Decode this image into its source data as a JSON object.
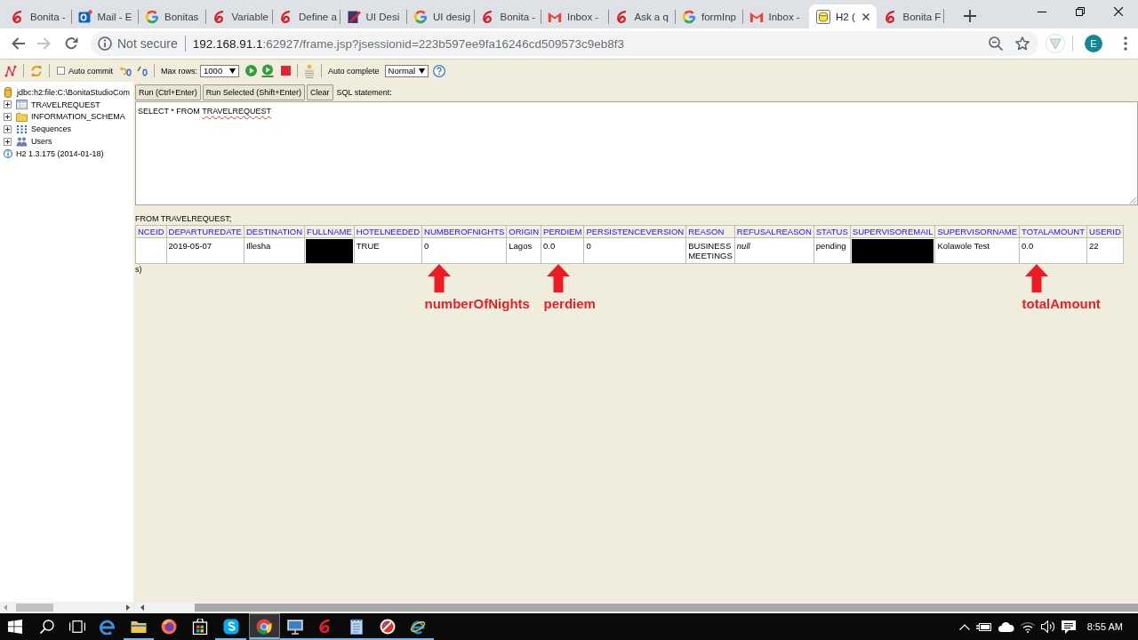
{
  "browser": {
    "tabs": [
      {
        "label": "Bonita -",
        "kind": "bonita",
        "selected": false
      },
      {
        "label": "Mail - E",
        "kind": "outlook",
        "selected": false
      },
      {
        "label": "Bonitas",
        "kind": "google",
        "selected": false
      },
      {
        "label": "Variable",
        "kind": "bonita",
        "selected": false
      },
      {
        "label": "Define a",
        "kind": "bonita",
        "selected": false
      },
      {
        "label": "UI Desi",
        "kind": "book",
        "selected": false
      },
      {
        "label": "UI desig",
        "kind": "google",
        "selected": false
      },
      {
        "label": "Bonita -",
        "kind": "bonita",
        "selected": false
      },
      {
        "label": "Inbox -",
        "kind": "gmail",
        "selected": false
      },
      {
        "label": "Ask a q",
        "kind": "bonita",
        "selected": false
      },
      {
        "label": "formInp",
        "kind": "google",
        "selected": false
      },
      {
        "label": "Inbox -",
        "kind": "gmail",
        "selected": false
      },
      {
        "label": "H2 (",
        "kind": "h2",
        "selected": true
      },
      {
        "label": "Bonita F",
        "kind": "bonita",
        "selected": false
      }
    ],
    "address": {
      "security": "Not secure",
      "host": "192.168.91.1",
      "path": ":62927/frame.jsp?jsessionid=223b597ee9fa16246cd509573c9eb8f3"
    },
    "profile": "E"
  },
  "toolbar": {
    "auto_commit": {
      "label": "Auto commit",
      "checked": false
    },
    "max_rows": {
      "label": "Max rows:",
      "value": "1000"
    },
    "auto_complete": {
      "label": "Auto complete",
      "value": "Normal"
    }
  },
  "sidebar": {
    "connection": "jdbc:h2:file:C:\\BonitaStudioCom",
    "items": [
      {
        "label": "TRAVELREQUEST",
        "kind": "table",
        "expanded": false
      },
      {
        "label": "INFORMATION_SCHEMA",
        "kind": "folder",
        "expanded": false
      },
      {
        "label": "Sequences",
        "kind": "sequences",
        "expanded": false
      },
      {
        "label": "Users",
        "kind": "users",
        "expanded": false
      }
    ],
    "version": "H2 1.3.175 (2014-01-18)"
  },
  "editor": {
    "buttons": [
      "Run (Ctrl+Enter)",
      "Run Selected (Shift+Enter)",
      "Clear"
    ],
    "label": "SQL statement:",
    "query": [
      {
        "text": "SELECT * FROM ",
        "misspelled": false
      },
      {
        "text": "TRAVELREQUEST",
        "misspelled": true
      }
    ]
  },
  "results": {
    "statement": "FROM TRAVELREQUEST;",
    "columns": [
      {
        "label": "NCEID"
      },
      {
        "label": "DEPARTUREDATE"
      },
      {
        "label": "DESTINATION"
      },
      {
        "label": "FULLNAME"
      },
      {
        "label": "HOTELNEEDED"
      },
      {
        "label": "NUMBEROFNIGHTS",
        "annotation": "numberOfNights"
      },
      {
        "label": "ORIGIN"
      },
      {
        "label": "PERDIEM",
        "annotation": "perdiem"
      },
      {
        "label": "PERSISTENCEVERSION"
      },
      {
        "label": "REASON"
      },
      {
        "label": "REFUSALREASON"
      },
      {
        "label": "STATUS"
      },
      {
        "label": "SUPERVISOREMAIL"
      },
      {
        "label": "SUPERVISORNAME"
      },
      {
        "label": "TOTALAMOUNT",
        "annotation": "totalAmount"
      },
      {
        "label": "USERID"
      }
    ],
    "rows": [
      [
        {
          "kind": "empty"
        },
        {
          "kind": "value",
          "text": "2019-05-07"
        },
        {
          "kind": "value",
          "text": "Illesha"
        },
        {
          "kind": "redacted"
        },
        {
          "kind": "value",
          "text": "TRUE"
        },
        {
          "kind": "value",
          "text": "0"
        },
        {
          "kind": "value",
          "text": "Lagos"
        },
        {
          "kind": "value",
          "text": "0.0"
        },
        {
          "kind": "value",
          "text": "0"
        },
        {
          "kind": "value",
          "text": "BUSINESS MEETINGS"
        },
        {
          "kind": "null",
          "text": "null"
        },
        {
          "kind": "value",
          "text": "pending"
        },
        {
          "kind": "redacted"
        },
        {
          "kind": "value",
          "text": "Kolawole Test"
        },
        {
          "kind": "value",
          "text": "0.0"
        },
        {
          "kind": "value",
          "text": "22"
        }
      ]
    ],
    "footer": "s)"
  },
  "taskbar": {
    "apps": [
      {
        "kind": "edge",
        "running": false,
        "selected": false
      },
      {
        "kind": "explorer",
        "running": true,
        "selected": false
      },
      {
        "kind": "firefox",
        "running": false,
        "selected": false
      },
      {
        "kind": "store",
        "running": false,
        "selected": false
      },
      {
        "kind": "skype",
        "running": true,
        "selected": false
      },
      {
        "kind": "chrome",
        "running": true,
        "selected": true
      },
      {
        "kind": "remote",
        "running": true,
        "selected": false
      },
      {
        "kind": "bonita",
        "running": true,
        "selected": false
      },
      {
        "kind": "notepad",
        "running": true,
        "selected": false
      },
      {
        "kind": "paint",
        "running": true,
        "selected": false
      },
      {
        "kind": "ie",
        "running": true,
        "selected": false
      }
    ],
    "clock": "8:55 AM"
  }
}
